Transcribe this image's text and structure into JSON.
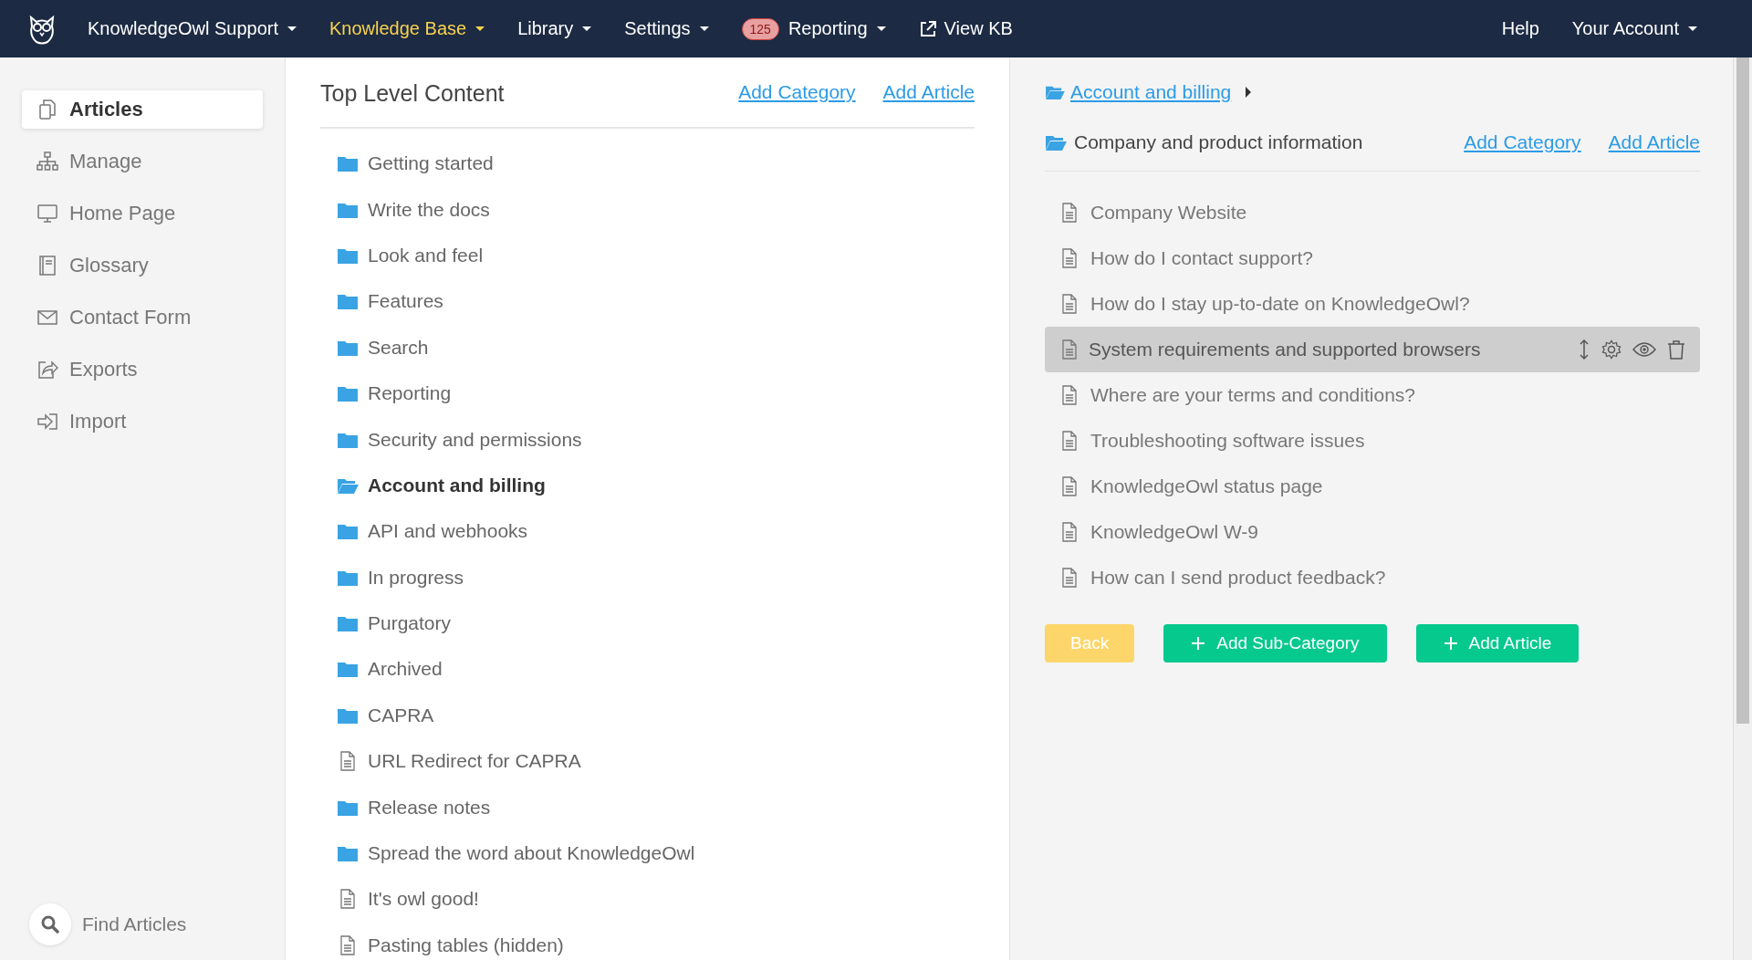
{
  "nav": {
    "items": [
      {
        "label": "KnowledgeOwl Support",
        "caret": true,
        "active": false,
        "kind": "menu"
      },
      {
        "label": "Knowledge Base",
        "caret": true,
        "active": true,
        "kind": "menu"
      },
      {
        "label": "Library",
        "caret": true,
        "active": false,
        "kind": "menu"
      },
      {
        "label": "Settings",
        "caret": true,
        "active": false,
        "kind": "menu"
      },
      {
        "label": "Reporting",
        "caret": true,
        "active": false,
        "kind": "menu",
        "badge": "125"
      },
      {
        "label": "View KB",
        "caret": false,
        "active": false,
        "kind": "external"
      }
    ],
    "right_items": [
      {
        "label": "Help",
        "caret": false
      },
      {
        "label": "Your Account",
        "caret": true
      }
    ]
  },
  "sidebar": {
    "items": [
      {
        "label": "Articles",
        "selected": true
      },
      {
        "label": "Manage",
        "selected": false
      },
      {
        "label": "Home Page",
        "selected": false
      },
      {
        "label": "Glossary",
        "selected": false
      },
      {
        "label": "Contact Form",
        "selected": false
      },
      {
        "label": "Exports",
        "selected": false
      },
      {
        "label": "Import",
        "selected": false
      }
    ],
    "find": "Find Articles"
  },
  "content": {
    "title": "Top Level Content",
    "links": [
      "Add Category",
      "Add Article"
    ],
    "items": [
      {
        "label": "Getting started",
        "kind": "folder",
        "selected": false
      },
      {
        "label": "Write the docs",
        "kind": "folder",
        "selected": false
      },
      {
        "label": "Look and feel",
        "kind": "folder",
        "selected": false
      },
      {
        "label": "Features",
        "kind": "folder",
        "selected": false
      },
      {
        "label": "Search",
        "kind": "folder",
        "selected": false
      },
      {
        "label": "Reporting",
        "kind": "folder",
        "selected": false
      },
      {
        "label": "Security and permissions",
        "kind": "folder",
        "selected": false
      },
      {
        "label": "Account and billing",
        "kind": "folder",
        "selected": true
      },
      {
        "label": "API and webhooks",
        "kind": "folder",
        "selected": false
      },
      {
        "label": "In progress",
        "kind": "folder",
        "selected": false
      },
      {
        "label": "Purgatory",
        "kind": "folder",
        "selected": false
      },
      {
        "label": "Archived",
        "kind": "folder",
        "selected": false
      },
      {
        "label": "CAPRA",
        "kind": "folder",
        "selected": false
      },
      {
        "label": "URL Redirect for CAPRA",
        "kind": "article",
        "selected": false
      },
      {
        "label": "Release notes",
        "kind": "folder",
        "selected": false
      },
      {
        "label": "Spread the word about KnowledgeOwl",
        "kind": "folder",
        "selected": false
      },
      {
        "label": "It's owl good!",
        "kind": "article",
        "selected": false
      },
      {
        "label": "Pasting tables (hidden)",
        "kind": "article",
        "selected": false
      }
    ]
  },
  "detail": {
    "breadcrumb": "Account and billing",
    "title": "Company and product information",
    "links": [
      "Add Category",
      "Add Article"
    ],
    "items": [
      {
        "label": "Company Website",
        "selected": false
      },
      {
        "label": "How do I contact support?",
        "selected": false
      },
      {
        "label": "How do I stay up-to-date on KnowledgeOwl?",
        "selected": false
      },
      {
        "label": "System requirements and supported browsers",
        "selected": true
      },
      {
        "label": "Where are your terms and conditions?",
        "selected": false
      },
      {
        "label": "Troubleshooting software issues",
        "selected": false
      },
      {
        "label": "KnowledgeOwl status page",
        "selected": false
      },
      {
        "label": "KnowledgeOwl W-9",
        "selected": false
      },
      {
        "label": "How can I send product feedback?",
        "selected": false
      }
    ],
    "buttons": [
      {
        "label": "Back",
        "kind": "back"
      },
      {
        "label": "Add Sub-Category",
        "kind": "add"
      },
      {
        "label": "Add Article",
        "kind": "add"
      }
    ]
  }
}
